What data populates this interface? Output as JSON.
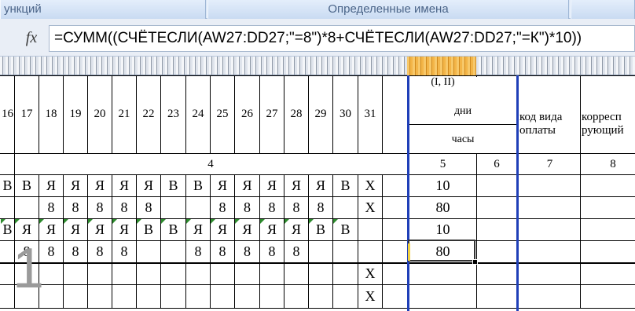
{
  "ribbon": {
    "group_functions": "ункций",
    "group_defined_names": "Определенные имена"
  },
  "formula_bar": {
    "fx_label": "fx",
    "formula": "=СУММ((СЧЁТЕСЛИ(AW27:DD27;\"=8\")*8+СЧЁТЕСЛИ(AW27:DD27;\"=К\")*10))"
  },
  "sheet": {
    "header_fragment": "(I, II)",
    "days_label": "дни",
    "hours_label": "часы",
    "pay_code_header": "код вида оплаты",
    "corresponding_header": "корресп рующий",
    "day_numbers": [
      "16",
      "17",
      "18",
      "19",
      "20",
      "21",
      "22",
      "23",
      "24",
      "25",
      "26",
      "27",
      "28",
      "29",
      "30",
      "31"
    ],
    "col_numbers": [
      "4",
      "5",
      "6",
      "7",
      "8"
    ],
    "rows": [
      {
        "days": [
          "В",
          "В",
          "Я",
          "Я",
          "Я",
          "Я",
          "Я",
          "В",
          "В",
          "Я",
          "Я",
          "Я",
          "Я",
          "Я",
          "В",
          "Х"
        ],
        "total": "10"
      },
      {
        "days": [
          "",
          "",
          "8",
          "8",
          "8",
          "8",
          "8",
          "",
          "",
          "8",
          "8",
          "8",
          "8",
          "8",
          "",
          "Х"
        ],
        "total": "80"
      },
      {
        "days": [
          "В",
          "Я",
          "Я",
          "Я",
          "Я",
          "Я",
          "В",
          "В",
          "Я",
          "Я",
          "Я",
          "Я",
          "Я",
          "В",
          "В",
          ""
        ],
        "total": "10"
      },
      {
        "days": [
          "",
          "8",
          "8",
          "8",
          "8",
          "8",
          "",
          "",
          "8",
          "8",
          "8",
          "8",
          "8",
          "",
          "",
          ""
        ],
        "total": "80"
      },
      {
        "days": [
          "",
          "",
          "",
          "",
          "",
          "",
          "",
          "",
          "",
          "",
          "",
          "",
          "",
          "",
          "",
          "Х"
        ],
        "total": ""
      },
      {
        "days": [
          "",
          "",
          "",
          "",
          "",
          "",
          "",
          "",
          "",
          "",
          "",
          "",
          "",
          "",
          "",
          "Х"
        ],
        "total": ""
      }
    ],
    "row_number_fragment": "1"
  },
  "colors": {
    "selection_border": "#1f3fb8",
    "column_highlight": "#f3b548",
    "error_triangle": "#2c8a2c"
  }
}
